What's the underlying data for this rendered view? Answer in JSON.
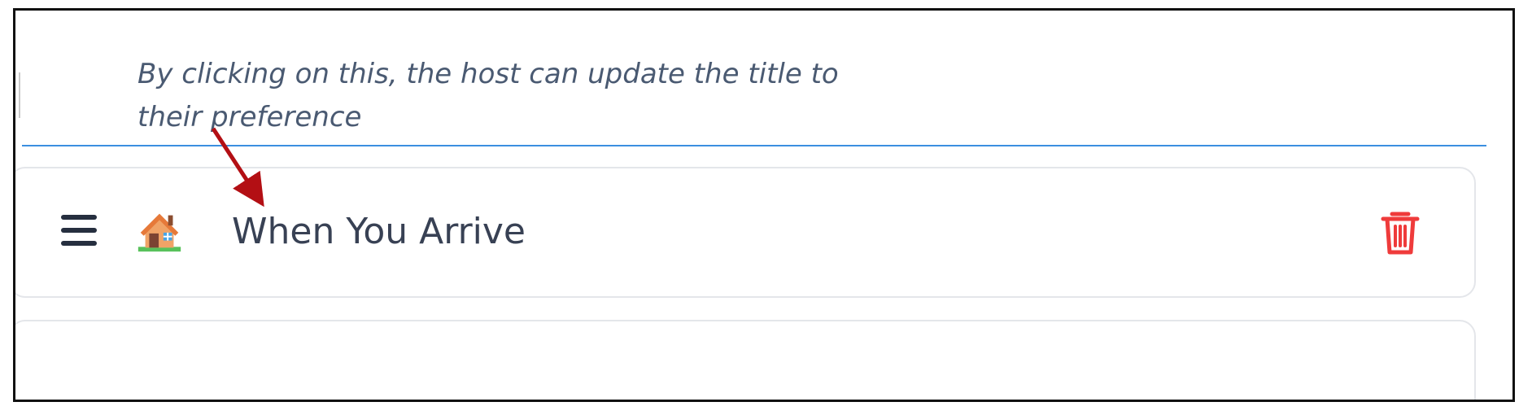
{
  "annotation": {
    "line1": "By clicking on this, the host can update the title to",
    "line2": "their preference"
  },
  "section": {
    "icon": "house-emoji-icon",
    "title": "When You Arrive",
    "drag_icon": "hamburger-menu-icon",
    "delete_icon": "trash-icon"
  },
  "colors": {
    "annotation_text": "#4a5a72",
    "divider": "#3b8fe0",
    "arrow": "#b30f14",
    "delete_icon": "#ef3b3b",
    "title_text": "#384154"
  }
}
